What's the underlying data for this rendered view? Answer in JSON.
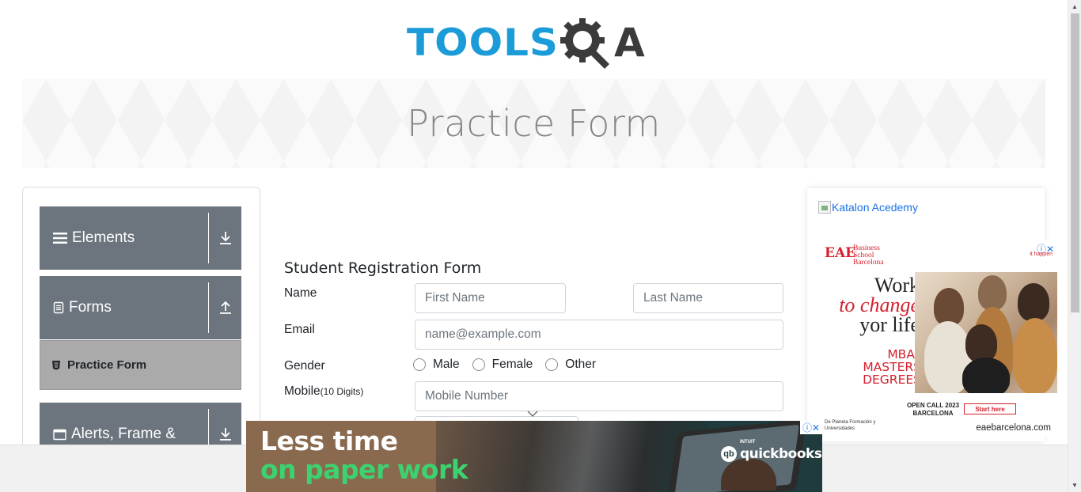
{
  "logo": {
    "tools": "TOOLS",
    "qa_letter": "A"
  },
  "banner": {
    "title": "Practice Form"
  },
  "sidebar": {
    "groups": [
      {
        "label": "Elements"
      },
      {
        "label": "Forms"
      },
      {
        "label": "Alerts, Frame &"
      }
    ],
    "active_item": "Practice Form"
  },
  "form": {
    "title": "Student Registration Form",
    "name_label": "Name",
    "first_name_placeholder": "First Name",
    "last_name_placeholder": "Last Name",
    "email_label": "Email",
    "email_placeholder": "name@example.com",
    "gender_label": "Gender",
    "gender_options": [
      "Male",
      "Female",
      "Other"
    ],
    "mobile_label": "Mobile",
    "mobile_hint": "(10 Digits)",
    "mobile_placeholder": "Mobile Number"
  },
  "side_ad": {
    "broken_image_alt": "Katalon Acedemy",
    "eae_logo": "EAE",
    "eae_school": "Business School Barcelona",
    "hidden_text": "it happen",
    "headline_1": "Work",
    "headline_2": "to change",
    "headline_3": "yor life",
    "programs": [
      "MBAs",
      "MASTERS",
      "DEGREES"
    ],
    "open_call": "OPEN CALL 2023 BARCELONA",
    "cta": "Start here",
    "sponsor": "De Planeta Formación y Universidades",
    "url": "eaebarcelona.com"
  },
  "bottom_ad": {
    "line1": "Less time",
    "line2": "on paper work",
    "brand_small": "INTUIT",
    "brand": "quickbooks",
    "brand_mark": "qb"
  },
  "colors": {
    "brand_blue": "#1b9bd7",
    "sidebar_gray": "#6c757d",
    "active_gray": "#aaaaaa",
    "eae_red": "#d4212e",
    "qb_green": "#3cd26f"
  }
}
